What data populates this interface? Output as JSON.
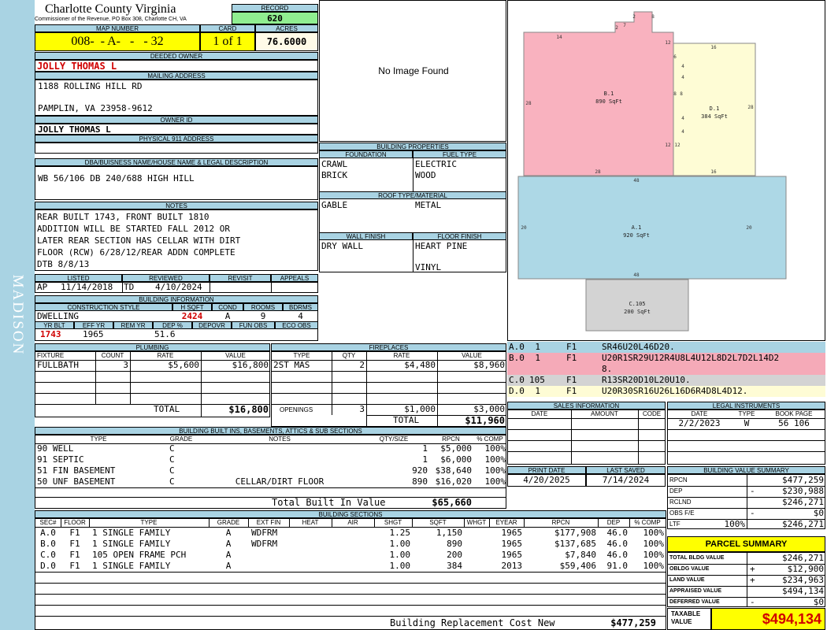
{
  "side_label": "MADISON",
  "header": {
    "county": "Charlotte County Virginia",
    "commissioner": "Commissioner of the Revenue, PO Box 308, Charlotte CH, VA",
    "record_label": "RECORD",
    "record": "620",
    "map_number_label": "MAP NUMBER",
    "map_number": "008-  - A-   -   - 32",
    "card_label": "CARD",
    "card": "1 of 1",
    "acres_label": "ACRES",
    "acres": "76.6000"
  },
  "owner": {
    "deeded_owner_label": "DEEDED OWNER",
    "deeded_owner": "JOLLY THOMAS L",
    "mailing_label": "MAILING ADDRESS",
    "mailing_line1": "1188 ROLLING HILL RD",
    "mailing_line2": "PAMPLIN, VA 23958-9612",
    "owner_id_label": "OWNER ID",
    "owner_id": "JOLLY THOMAS L",
    "physical_label": "PHYSICAL 911 ADDRESS",
    "physical": "",
    "dba_label": "DBA/BUISNESS NAME/HOUSE NAME & LEGAL DESCRIPTION",
    "dba": "WB 56/106 DB 240/688 HIGH HILL"
  },
  "notes": {
    "label": "NOTES",
    "lines": [
      "REAR BUILT 1743, FRONT BUILT 1810",
      "ADDITION WILL BE STARTED FALL 2012 OR",
      "LATER REAR SECTION HAS CELLAR WITH DIRT",
      "FLOOR (RCW) 6/28/12/REAR ADDN COMPLETE",
      "DTB 8/8/13"
    ]
  },
  "review": {
    "listed_label": "LISTED",
    "reviewed_label": "REVIEWED",
    "revisit_label": "REVISIT",
    "appeals_label": "APPEALS",
    "listed_code": "AP",
    "listed_date": "11/14/2018",
    "reviewed_code": "TD",
    "reviewed_date": "4/10/2024"
  },
  "building_info": {
    "label": "BUILDING INFORMATION",
    "construction_label": "CONSTRUCTION STYLE",
    "hsqft_label": "H SQFT",
    "cond_label": "COND",
    "rooms_label": "ROOMS",
    "bdrms_label": "BDRMS",
    "construction": "DWELLING",
    "hsqft": "2424",
    "cond": "A",
    "rooms": "9",
    "bdrms": "4",
    "yr_blt_label": "YR BLT",
    "eff_yr_label": "EFF YR",
    "rem_yr_label": "REM YR",
    "dep_label": "DEP %",
    "depovr_label": "DEPOVR",
    "fun_obs_label": "FUN OBS",
    "eco_obs_label": "ECO OBS",
    "yr_blt": "1743",
    "eff_yr": "1965",
    "rem_yr": "",
    "dep": "51.6"
  },
  "building_properties": {
    "label": "BUILDING PROPERTIES",
    "foundation_label": "FOUNDATION",
    "fuel_label": "FUEL TYPE",
    "foundation1": "CRAWL",
    "foundation2": "BRICK",
    "fuel1": "ELECTRIC",
    "fuel2": "WOOD",
    "roof_label": "ROOF TYPE/MATERIAL",
    "roof1": "GABLE",
    "roof2": "METAL",
    "wall_label": "WALL FINISH",
    "floor_label": "FLOOR FINISH",
    "wall1": "DRY WALL",
    "floor1": "HEART PINE",
    "floor2": "VINYL"
  },
  "no_image": "No Image Found",
  "plumbing": {
    "label": "PLUMBING",
    "headers": [
      "FIXTURE",
      "COUNT",
      "RATE",
      "VALUE"
    ],
    "rows": [
      [
        "FULLBATH",
        "3",
        "$5,600",
        "$16,800"
      ]
    ],
    "total_label": "TOTAL",
    "total": "$16,800"
  },
  "fireplaces": {
    "label": "FIREPLACES",
    "headers": [
      "TYPE",
      "QTY",
      "RATE",
      "VALUE"
    ],
    "rows": [
      [
        "2ST MAS",
        "2",
        "$4,480",
        "$8,960"
      ]
    ],
    "openings_label": "OPENINGS",
    "openings_qty": "3",
    "openings_rate": "$1,000",
    "openings_value": "$3,000",
    "total_label": "TOTAL",
    "total": "$11,960"
  },
  "built_ins": {
    "label": "BUILDING BUILT INS, BASEMENTS, ATTICS & SUB SECTIONS",
    "headers": [
      "TYPE",
      "GRADE",
      "NOTES",
      "QTY/SIZE",
      "RPCN",
      "% COMP"
    ],
    "rows": [
      [
        "90 WELL",
        "C",
        "",
        "1",
        "$5,000",
        "100%"
      ],
      [
        "91 SEPTIC",
        "C",
        "",
        "1",
        "$6,000",
        "100%"
      ],
      [
        "51 FIN BASEMENT",
        "C",
        "",
        "920",
        "$38,640",
        "100%"
      ],
      [
        "50 UNF BASEMENT",
        "C",
        "CELLAR/DIRT FLOOR",
        "890",
        "$16,020",
        "100%"
      ]
    ],
    "total_label": "Total Built In Value",
    "total": "$65,660"
  },
  "building_sections": {
    "label": "BUILDING SECTIONS",
    "headers": [
      "SEC#",
      "FLOOR",
      "TYPE",
      "GRADE",
      "EXT FIN",
      "HEAT",
      "AIR",
      "SHGT",
      "SQFT",
      "WHGT",
      "EYEAR",
      "RPCN",
      "DEP",
      "% COMP"
    ],
    "rows": [
      [
        "A.0",
        "F1",
        "1 SINGLE FAMILY",
        "A",
        "WDFRM",
        "",
        "",
        "1.25",
        "1,150",
        "",
        "1965",
        "$177,908",
        "46.0",
        "100%"
      ],
      [
        "B.0",
        "F1",
        "1 SINGLE FAMILY",
        "A",
        "WDFRM",
        "",
        "",
        "1.00",
        "890",
        "",
        "1965",
        "$137,685",
        "46.0",
        "100%"
      ],
      [
        "C.0",
        "F1",
        "105 OPEN FRAME PCH",
        "A",
        "",
        "",
        "",
        "1.00",
        "200",
        "",
        "1965",
        "$7,840",
        "46.0",
        "100%"
      ],
      [
        "D.0",
        "F1",
        "1 SINGLE FAMILY",
        "A",
        "",
        "",
        "",
        "1.00",
        "384",
        "",
        "2013",
        "$59,406",
        "91.0",
        "100%"
      ]
    ],
    "brcn_label": "Building Replacement Cost New",
    "brcn": "$477,259"
  },
  "sketch": {
    "labels": [
      {
        "id": "B.1",
        "area": "890 SqFt"
      },
      {
        "id": "D.1",
        "area": "384 SqFt"
      },
      {
        "id": "A.1",
        "area": "920 SqFt"
      },
      {
        "id": "C.105",
        "area": "200 SqFt"
      }
    ],
    "dims": [
      "2",
      "8",
      "2",
      "7",
      "14",
      "12",
      "16",
      "6",
      "4",
      "4",
      "28",
      "8",
      "8",
      "28",
      "4",
      "4",
      "12",
      "12",
      "28",
      "16",
      "48",
      "20",
      "20",
      "48"
    ]
  },
  "legend_rows": [
    {
      "sec": "A.0",
      "num": "1",
      "fl": "F1",
      "code": "SR46U20L46D20.",
      "color": "#a9d3e3"
    },
    {
      "sec": "B.0",
      "num": "1",
      "fl": "F1",
      "code": "U20R1SR29U12R4U8L4U12L8D2L7D2L14D2",
      "code2": "8.",
      "color": "#f5aab8"
    },
    {
      "sec": "C.0",
      "num": "105",
      "fl": "F1",
      "code": "R13SR20D10L20U10.",
      "color": "#d3d3d3"
    },
    {
      "sec": "D.0",
      "num": "1",
      "fl": "F1",
      "code": "U20R30SR16U26L16D6R4D8L4D12.",
      "color": "#fefcd5"
    }
  ],
  "sales": {
    "label": "SALES INFORMATION",
    "headers": [
      "DATE",
      "AMOUNT",
      "CODE"
    ]
  },
  "legal": {
    "label": "LEGAL INSTRUMENTS",
    "headers": [
      "DATE",
      "TYPE",
      "BOOK PAGE"
    ],
    "rows": [
      [
        "2/2/2023",
        "W",
        "56 106"
      ]
    ]
  },
  "print_info": {
    "print_label": "PRINT DATE",
    "saved_label": "LAST SAVED",
    "print_date": "4/20/2025",
    "last_saved": "7/14/2024"
  },
  "value_summary": {
    "label": "BUILDING VALUE SUMMARY",
    "rows": [
      {
        "label": "RPCN",
        "sign": "",
        "value": "$477,259"
      },
      {
        "label": "DEP",
        "sign": "-",
        "value": "$230,988"
      },
      {
        "label": "RCLND",
        "sign": "",
        "value": "$246,271"
      },
      {
        "label": "OBS F/E",
        "sign": "-",
        "value": "$0"
      },
      {
        "label": "LTF",
        "pct": "100%",
        "sign": "",
        "value": "$246,271"
      }
    ]
  },
  "parcel_summary": {
    "label": "PARCEL SUMMARY",
    "rows": [
      {
        "label": "TOTAL BLDG VALUE",
        "sign": "",
        "value": "$246,271"
      },
      {
        "label": "OBLDG VALUE",
        "sign": "+",
        "value": "$12,900"
      },
      {
        "label": "LAND VALUE",
        "sign": "+",
        "value": "$234,963"
      },
      {
        "label": "APPRAISED VALUE",
        "sign": "",
        "value": "$494,134"
      },
      {
        "label": "DEFERRED VALUE",
        "sign": "-",
        "value": "$0"
      }
    ],
    "taxable_label1": "TAXABLE",
    "taxable_label2": "VALUE",
    "taxable": "$494,134"
  }
}
